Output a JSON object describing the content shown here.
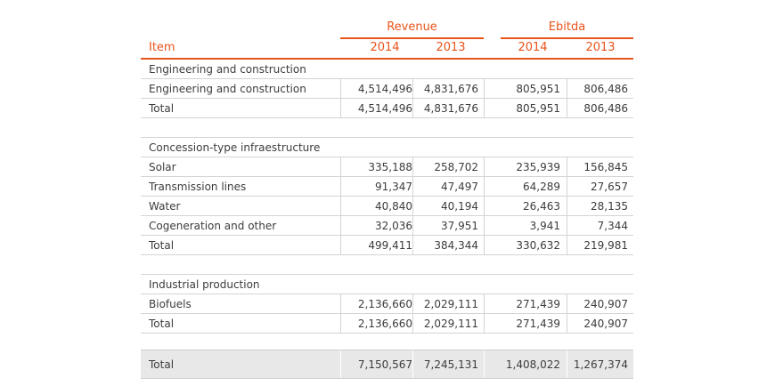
{
  "table": {
    "groups": {
      "revenue": "Revenue",
      "ebitda": "Ebitda"
    },
    "headers": {
      "item": "Item",
      "rev_2014": "2014",
      "rev_2013": "2013",
      "ebi_2014": "2014",
      "ebi_2013": "2013"
    },
    "colors": {
      "accent": "#e9541c",
      "rule": "#d4d4d4",
      "grand_bg": "#e8e8e8"
    },
    "sections": [
      {
        "title": "Engineering and construction",
        "rows": [
          {
            "label": "Engineering and construction",
            "rev_2014": "4,514,496",
            "rev_2013": "4,831,676",
            "ebi_2014": "805,951",
            "ebi_2013": "806,486"
          },
          {
            "label": "Total",
            "rev_2014": "4,514,496",
            "rev_2013": "4,831,676",
            "ebi_2014": "805,951",
            "ebi_2013": "806,486"
          }
        ]
      },
      {
        "title": "Concession-type infraestructure",
        "rows": [
          {
            "label": "Solar",
            "rev_2014": "335,188",
            "rev_2013": "258,702",
            "ebi_2014": "235,939",
            "ebi_2013": "156,845"
          },
          {
            "label": "Transmission lines",
            "rev_2014": "91,347",
            "rev_2013": "47,497",
            "ebi_2014": "64,289",
            "ebi_2013": "27,657"
          },
          {
            "label": "Water",
            "rev_2014": "40,840",
            "rev_2013": "40,194",
            "ebi_2014": "26,463",
            "ebi_2013": "28,135"
          },
          {
            "label": "Cogeneration and other",
            "rev_2014": "32,036",
            "rev_2013": "37,951",
            "ebi_2014": "3,941",
            "ebi_2013": "7,344"
          },
          {
            "label": "Total",
            "rev_2014": "499,411",
            "rev_2013": "384,344",
            "ebi_2014": "330,632",
            "ebi_2013": "219,981"
          }
        ]
      },
      {
        "title": "Industrial production",
        "rows": [
          {
            "label": "Biofuels",
            "rev_2014": "2,136,660",
            "rev_2013": "2,029,111",
            "ebi_2014": "271,439",
            "ebi_2013": "240,907"
          },
          {
            "label": "Total",
            "rev_2014": "2,136,660",
            "rev_2013": "2,029,111",
            "ebi_2014": "271,439",
            "ebi_2013": "240,907"
          }
        ]
      }
    ],
    "grand_total": {
      "label": "Total",
      "rev_2014": "7,150,567",
      "rev_2013": "7,245,131",
      "ebi_2014": "1,408,022",
      "ebi_2013": "1,267,374"
    }
  }
}
